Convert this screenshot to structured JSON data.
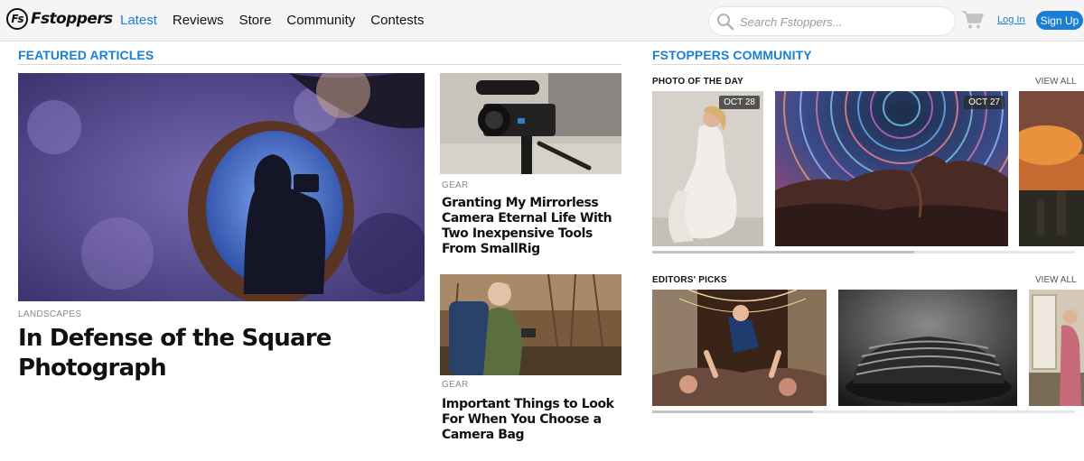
{
  "header": {
    "logo_badge": "Fs",
    "logo_text": "Fstoppers",
    "nav": [
      {
        "label": "Latest",
        "active": true
      },
      {
        "label": "Reviews"
      },
      {
        "label": "Store"
      },
      {
        "label": "Community"
      },
      {
        "label": "Contests"
      }
    ],
    "search_placeholder": "Search Fstoppers...",
    "login_label": "Log In",
    "signup_label": "Sign Up"
  },
  "featured": {
    "title": "FEATURED ARTICLES",
    "main": {
      "category": "LANDSCAPES",
      "headline": "In Defense of the Square Photograph"
    },
    "side": [
      {
        "category": "GEAR",
        "headline": "Granting My Mirrorless Camera Eternal Life With Two Inexpensive Tools From SmallRig"
      },
      {
        "category": "GEAR",
        "headline": "Important Things to Look For When You Choose a Camera Bag"
      }
    ]
  },
  "community": {
    "title": "FSTOPPERS COMMUNITY",
    "photo_of_day": {
      "title": "PHOTO OF THE DAY",
      "view_all": "VIEW ALL",
      "dates": [
        "OCT 28",
        "OCT 27"
      ],
      "scroll_progress": 0.62
    },
    "editors_picks": {
      "title": "EDITORS' PICKS",
      "view_all": "VIEW ALL",
      "scroll_progress": 0.38
    }
  },
  "colors": {
    "accent": "#1a7fd4",
    "text": "#111111",
    "muted": "#888888"
  }
}
